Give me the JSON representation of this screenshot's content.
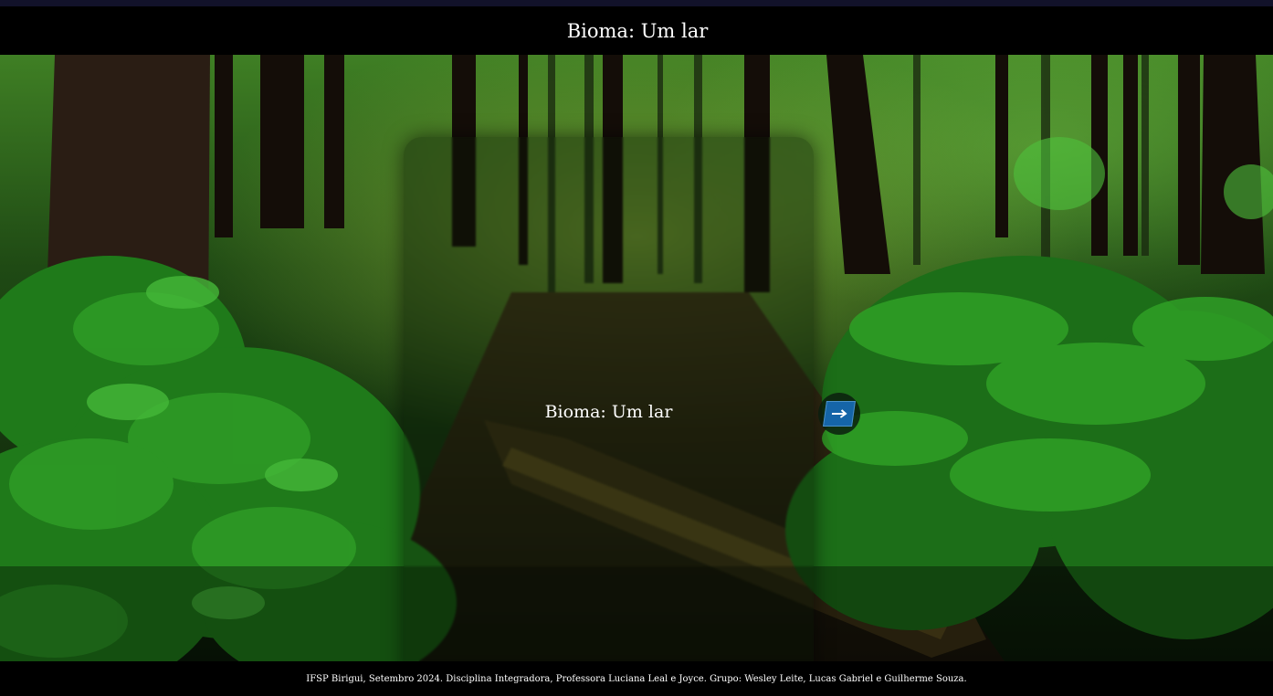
{
  "header": {
    "title": "Bioma: Um lar"
  },
  "hero": {
    "background_image": "forest-background",
    "card": {
      "title": "Bioma: Um lar"
    },
    "next_button": {
      "icon": "arrow-right-icon",
      "color": "#1565a8"
    }
  },
  "footer": {
    "text": "IFSP Birigui, Setembro 2024. Disciplina Integradora, Professora Luciana Leal e Joyce. Grupo: Wesley Leite, Lucas Gabriel e Guilherme Souza."
  },
  "colors": {
    "header_bg": "#000000",
    "footer_bg": "#000000",
    "text": "#ffffff",
    "accent": "#1565a8"
  }
}
